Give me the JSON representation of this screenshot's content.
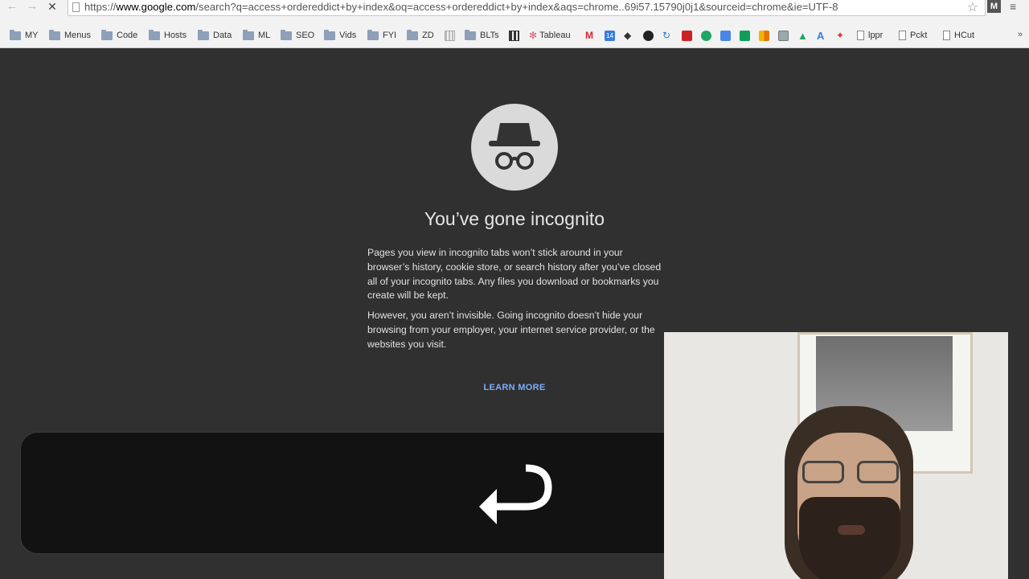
{
  "browser": {
    "url_prefix": "https://",
    "url_host": "www.google.com",
    "url_rest": "/search?q=access+ordereddict+by+index&oq=access+ordereddict+by+index&aqs=chrome..69i57.15790j0j1&sourceid=chrome&ie=UTF-8",
    "back_glyph": "←",
    "forward_glyph": "→",
    "stop_glyph": "✕",
    "star_glyph": "☆",
    "ext_label": "M",
    "menu_glyph": "≡"
  },
  "bookmarks": [
    {
      "label": "MY",
      "icon": "folder-icon"
    },
    {
      "label": "Menus",
      "icon": "folder-icon"
    },
    {
      "label": "Code",
      "icon": "folder-icon"
    },
    {
      "label": "Hosts",
      "icon": "folder-icon"
    },
    {
      "label": "Data",
      "icon": "folder-icon"
    },
    {
      "label": "ML",
      "icon": "folder-icon"
    },
    {
      "label": "SEO",
      "icon": "folder-icon"
    },
    {
      "label": "Vids",
      "icon": "folder-icon"
    },
    {
      "label": "FYI",
      "icon": "folder-icon"
    },
    {
      "label": "ZD",
      "icon": "folder-icon"
    },
    {
      "label": "BLTs",
      "icon": "folder-icon"
    },
    {
      "label": "Tableau",
      "icon": "tableau-icon"
    },
    {
      "label": "lppr",
      "icon": "page-icon"
    },
    {
      "label": "Pckt",
      "icon": "page-icon"
    },
    {
      "label": "HCut",
      "icon": "page-icon"
    }
  ],
  "bookmarks_overflow": "»",
  "incognito": {
    "title": "You’ve gone incognito",
    "para1": "Pages you view in incognito tabs won’t stick around in your browser’s history, cookie store, or search history after you’ve closed all of your incognito tabs. Any files you download or bookmarks you create will be kept.",
    "para2": "However, you aren’t invisible. Going incognito doesn’t hide your browsing from your employer, your internet service provider, or the websites you visit.",
    "learn_more": "LEARN MORE"
  },
  "colors": {
    "page_bg": "#303030",
    "link": "#7cacf8",
    "keycap": "#121212"
  }
}
